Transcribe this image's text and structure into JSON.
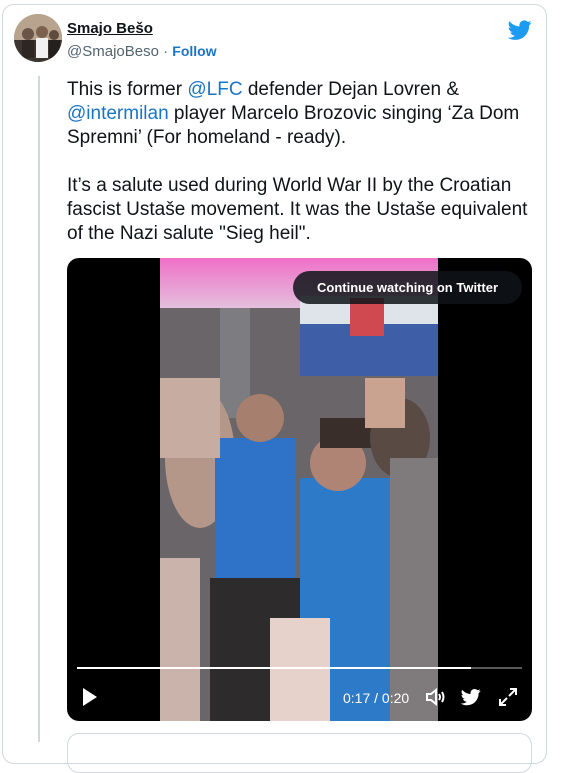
{
  "author": {
    "name": "Smajo Bešo",
    "handle": "@SmajoBeso",
    "separator": "·",
    "follow_label": "Follow"
  },
  "tweet": {
    "p1_part1": "This is former ",
    "p1_mention1": "@LFC",
    "p1_part2": " defender Dejan Lovren & ",
    "p1_mention2": "@intermilan",
    "p1_part3": " player Marcelo Brozovic singing ‘Za Dom Spremni’ (For homeland - ready).",
    "p2": "It’s a salute used during World War II by the Croatian fascist Ustaše movement. It was the Ustaše equivalent of the Nazi salute \"Sieg heil\"."
  },
  "video": {
    "continue_label": "Continue watching on Twitter",
    "time": "0:17 / 0:20",
    "progress": 0.885
  },
  "icons": {
    "logo": "twitter-bird-icon",
    "play": "play-icon",
    "volume": "volume-icon",
    "share": "twitter-bird-icon",
    "fullscreen": "expand-icon"
  },
  "colors": {
    "link": "#1b74c5",
    "twitter_blue": "#1d9bf0",
    "text": "#0f1419",
    "muted": "#536471"
  }
}
